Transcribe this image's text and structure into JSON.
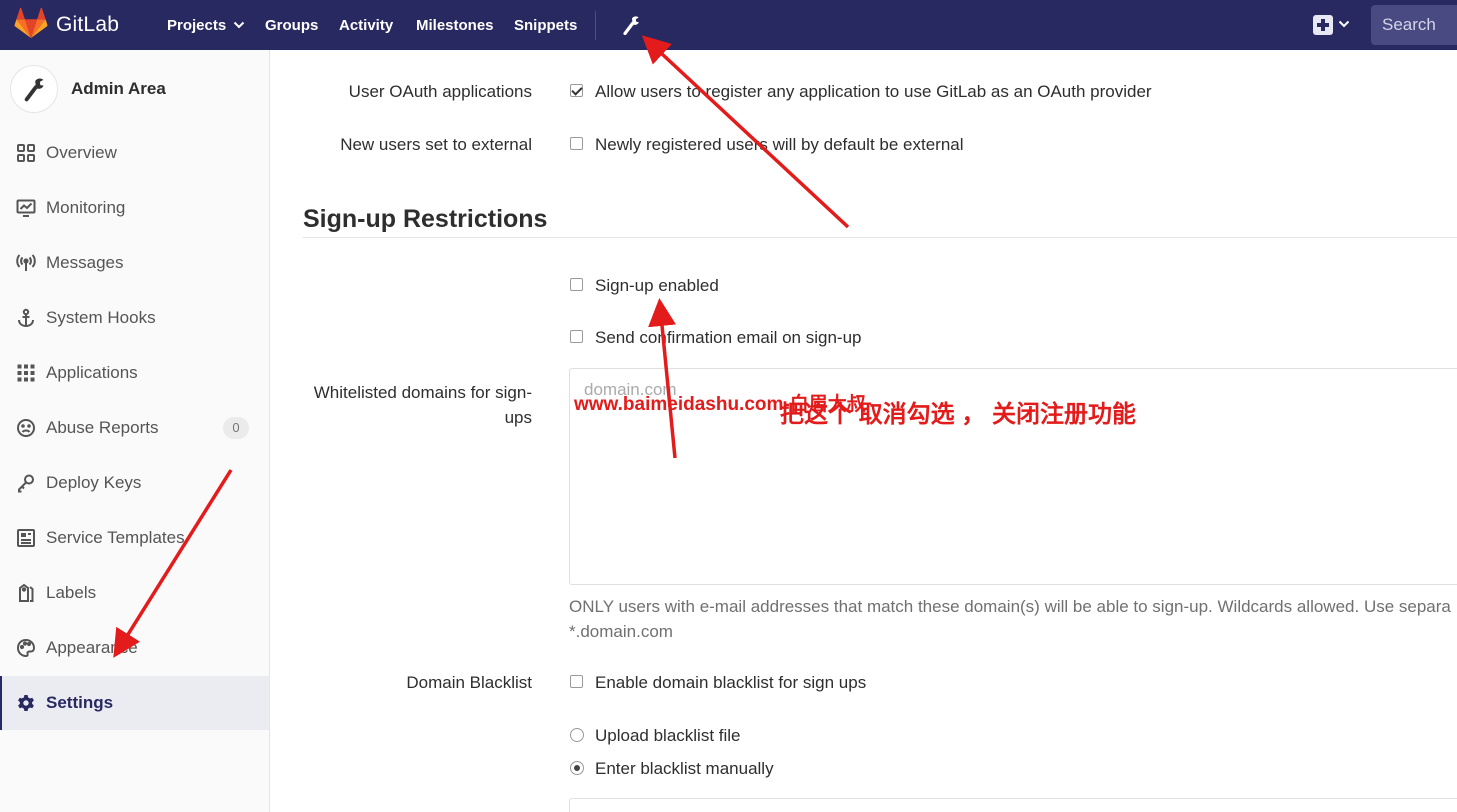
{
  "navbar": {
    "brand": "GitLab",
    "links": [
      "Projects",
      "Groups",
      "Activity",
      "Milestones",
      "Snippets"
    ],
    "admin_icon": "wrench-icon",
    "new_icon": "plus-square-icon",
    "search_placeholder": "Search",
    "background": "#292961"
  },
  "sidebar": {
    "title": "Admin Area",
    "items": [
      {
        "label": "Overview",
        "icon": "overview-icon"
      },
      {
        "label": "Monitoring",
        "icon": "monitoring-icon"
      },
      {
        "label": "Messages",
        "icon": "broadcast-icon"
      },
      {
        "label": "System Hooks",
        "icon": "anchor-icon"
      },
      {
        "label": "Applications",
        "icon": "applications-icon"
      },
      {
        "label": "Abuse Reports",
        "icon": "frown-icon",
        "count": "0"
      },
      {
        "label": "Deploy Keys",
        "icon": "key-icon"
      },
      {
        "label": "Service Templates",
        "icon": "template-icon"
      },
      {
        "label": "Labels",
        "icon": "label-icon"
      },
      {
        "label": "Appearance",
        "icon": "palette-icon"
      },
      {
        "label": "Settings",
        "icon": "gear-icon",
        "active": true
      }
    ]
  },
  "main": {
    "oauth": {
      "label": "User OAuth applications",
      "option": "Allow users to register any application to use GitLab as an OAuth provider",
      "checked": true
    },
    "external": {
      "label": "New users set to external",
      "option": "Newly registered users will by default be external",
      "checked": false
    },
    "section_title": "Sign-up Restrictions",
    "signup_enabled": {
      "option": "Sign-up enabled",
      "checked": false
    },
    "send_confirmation": {
      "option": "Send confirmation email on sign-up",
      "checked": false
    },
    "whitelist": {
      "label": "Whitelisted domains for sign-ups",
      "placeholder": "domain.com",
      "help_line1": "ONLY users with e-mail addresses that match these domain(s) will be able to sign-up. Wildcards allowed. Use separa",
      "help_line2": "*.domain.com"
    },
    "blacklist": {
      "label": "Domain Blacklist",
      "option": "Enable domain blacklist for sign ups",
      "checked": false,
      "upload_option": "Upload blacklist file",
      "manual_option": "Enter blacklist manually",
      "selected": "manual"
    }
  },
  "annotations": {
    "watermark": "www.baimeidashu.com-白眉大叔",
    "note": "把这个 取消勾选 ， 关闭注册功能",
    "color": "#e31b1b"
  }
}
